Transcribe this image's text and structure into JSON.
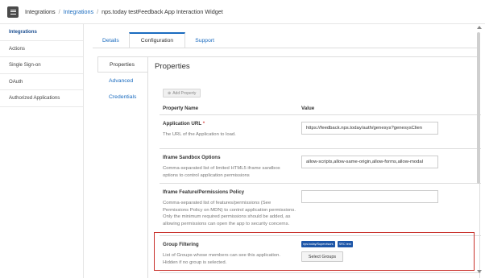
{
  "breadcrumb": {
    "root": "Integrations",
    "link": "Integrations",
    "current": "nps.today testFeedback App Interaction Widget"
  },
  "sidebar": {
    "items": [
      {
        "label": "Integrations"
      },
      {
        "label": "Actions"
      },
      {
        "label": "Single Sign-on"
      },
      {
        "label": "OAuth"
      },
      {
        "label": "Authorized Applications"
      }
    ]
  },
  "tabs": [
    {
      "label": "Details"
    },
    {
      "label": "Configuration"
    },
    {
      "label": "Support"
    }
  ],
  "subnav": [
    {
      "label": "Properties"
    },
    {
      "label": "Advanced"
    },
    {
      "label": "Credentials"
    }
  ],
  "panel": {
    "title": "Properties",
    "add_property": "Add Property",
    "col_name": "Property Name",
    "col_value": "Value"
  },
  "properties": [
    {
      "name": "Application URL",
      "required": "*",
      "description": "The URL of the Application to load.",
      "value": "https://feedback.nps.today/auth/genesys?genesysClien"
    },
    {
      "name": "Iframe Sandbox Options",
      "description": "Comma-separated list of limited HTML5 iframe sandbox options to control application permissions",
      "value": "allow-scripts,allow-same-origin,allow-forms,allow-modal"
    },
    {
      "name": "Iframe Feature/Permissions Policy",
      "description": "Comma-separated list of features/permissions (See Permissions Policy on MDN) to control application permissions. Only the minimum required permissions should be added, as allowing permissions can open the app to security concerns.",
      "value": ""
    },
    {
      "name": "Group Filtering",
      "description": "List of Groups whose members can see this application. Hidden if no group is selected.",
      "groups": [
        "nps.today/Supervisors",
        "SRC test"
      ],
      "button": "Select Groups"
    }
  ],
  "colors": {
    "link": "#1a6bbf",
    "badge": "#1d56a8",
    "highlight": "#c8302a",
    "required": "#d9534f"
  }
}
